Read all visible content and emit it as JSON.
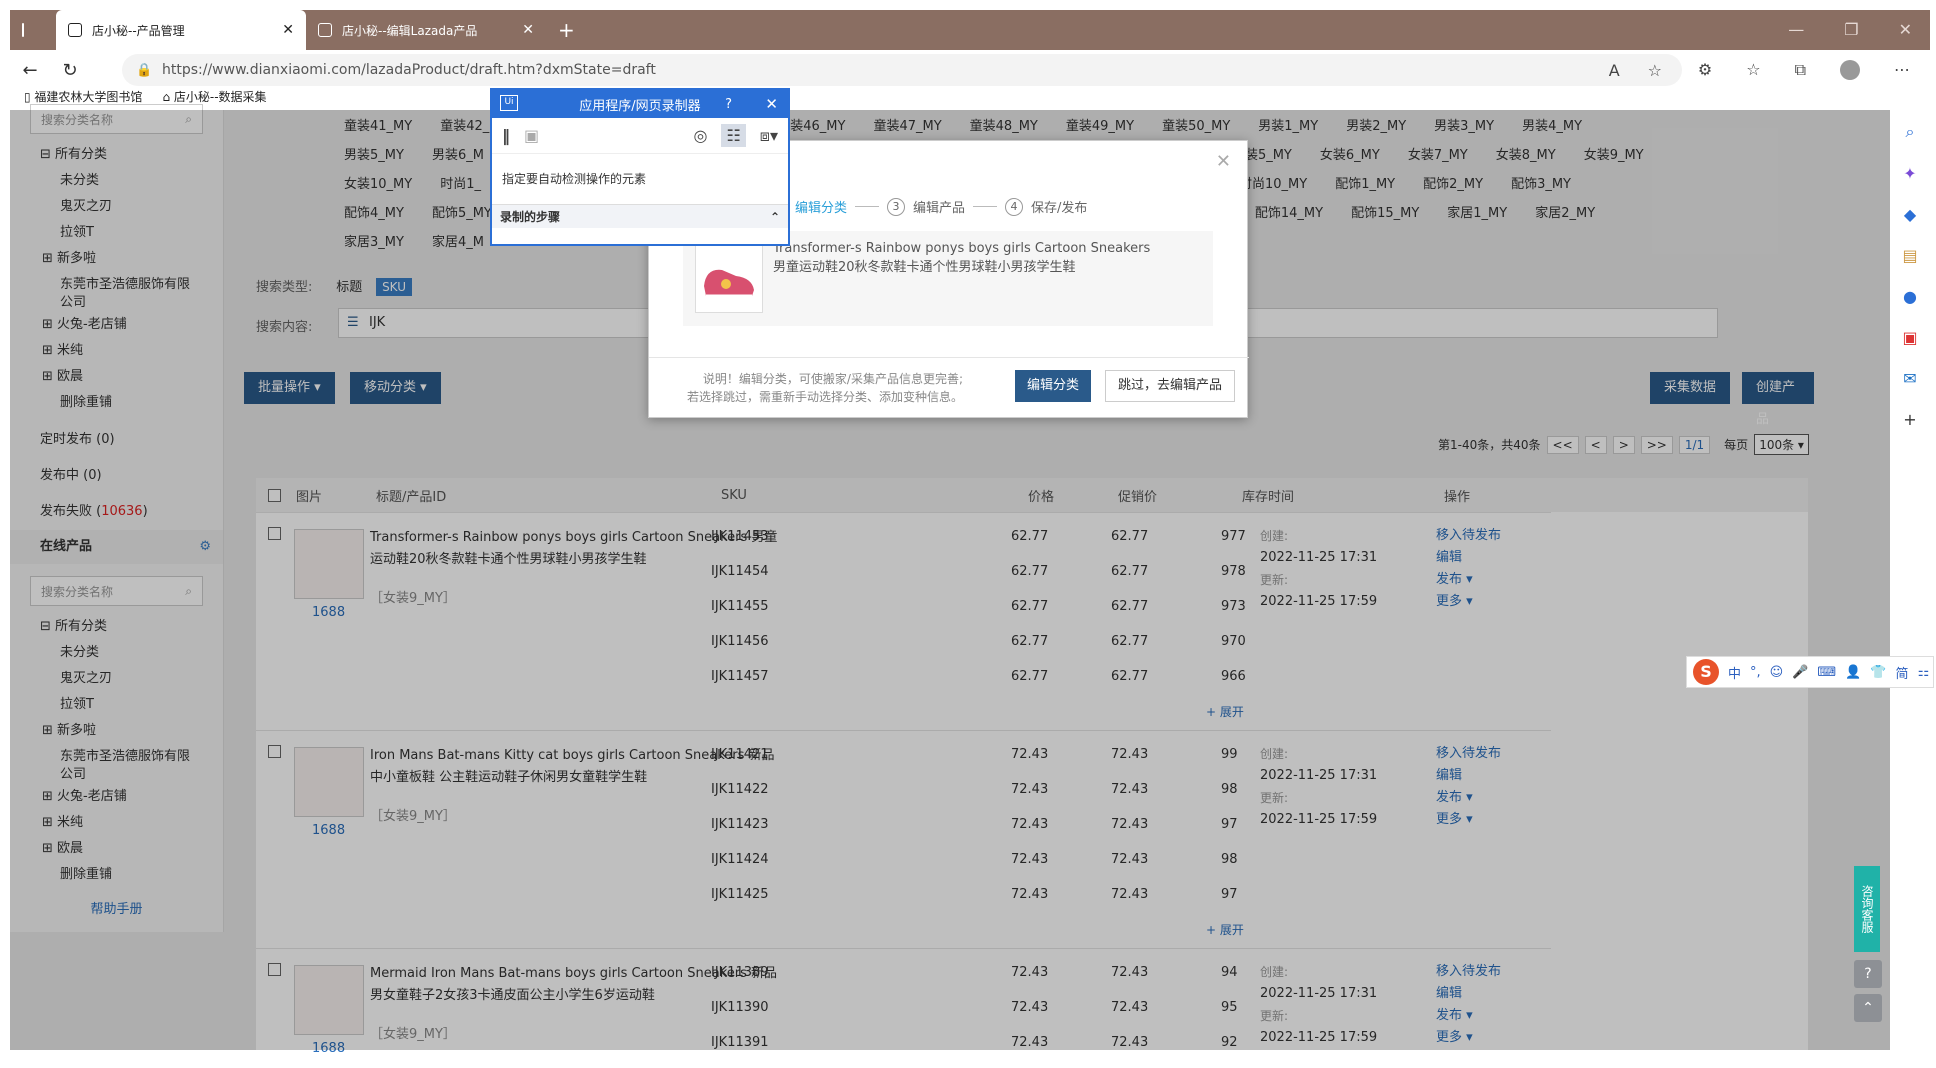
{
  "browser": {
    "tabs": [
      {
        "label": "店小秘--产品管理"
      },
      {
        "label": "店小秘--编辑Lazada产品"
      }
    ],
    "url": "https://www.dianxiaomi.com/lazadaProduct/draft.htm?dxmState=draft",
    "bookmarks": [
      "福建农林大学图书馆",
      "店小秘--数据采集"
    ]
  },
  "sidebar": {
    "search_placeholder": "搜索分类名称",
    "tree1": [
      "所有分类",
      "未分类",
      "鬼灭之刃",
      "拉领T",
      "新多啦",
      "东莞市圣浩德服饰有限公司",
      "火兔-老店铺",
      "米纯",
      "欧晨",
      "删除重铺"
    ],
    "links": {
      "scheduled": "定时发布 (0)",
      "publishing": "发布中 (0)",
      "failed_label": "发布失败 (",
      "failed_count": "10636",
      "failed_end": ")"
    },
    "online_label": "在线产品",
    "search2_placeholder": "搜索分类名称",
    "tree2": [
      "所有分类",
      "未分类",
      "鬼灭之刃",
      "拉领T",
      "新多啦",
      "东莞市圣浩德服饰有限公司",
      "火兔-老店铺",
      "米纯",
      "欧晨",
      "删除重铺"
    ],
    "help": "帮助手册"
  },
  "chips": {
    "row1": [
      "童装41_MY",
      "童装42_",
      "童装46_MY",
      "童装47_MY",
      "童装48_MY",
      "童装49_MY",
      "童装50_MY",
      "男装1_MY",
      "男装2_MY",
      "男装3_MY",
      "男装4_MY"
    ],
    "row2": [
      "男装5_MY",
      "男装6_M",
      "女装5_MY",
      "女装6_MY",
      "女装7_MY",
      "女装8_MY",
      "女装9_MY"
    ],
    "row3": [
      "女装10_MY",
      "时尚1_",
      "时尚10_MY",
      "配饰1_MY",
      "配饰2_MY",
      "配饰3_MY"
    ],
    "row4": [
      "配饰4_MY",
      "配饰5_MY",
      "配饰14_MY",
      "配饰15_MY",
      "家居1_MY",
      "家居2_MY"
    ],
    "row5": [
      "家居3_MY",
      "家居4_M"
    ]
  },
  "search": {
    "type_label": "搜索类型:",
    "type_title": "标题",
    "type_sku": "SKU",
    "content_label": "搜索内容:",
    "content_value": "IJK"
  },
  "toolbar": {
    "batch": "批量操作",
    "move": "移动分类",
    "collect": "采集数据",
    "create": "创建产品",
    "pagination": "第1-40条，共40条",
    "page": "1/1",
    "per_page_label": "每页",
    "per_page_value": "100条",
    "pager": [
      "<<",
      "<",
      ">",
      ">>"
    ]
  },
  "table": {
    "headers": [
      "图片",
      "标题/产品ID",
      "SKU",
      "价格",
      "促销价",
      "库存",
      "时间",
      "操作"
    ],
    "products": [
      {
        "img_label": "1688",
        "title": "Transformer-s Rainbow ponys boys girls Cartoon Sneakers 男童运动鞋20秋冬款鞋卡通个性男球鞋小男孩学生鞋",
        "tag": "［女装9_MY］",
        "rows": [
          {
            "sku": "IJK11453",
            "price": "62.77",
            "promo": "62.77",
            "stock": "977"
          },
          {
            "sku": "IJK11454",
            "price": "62.77",
            "promo": "62.77",
            "stock": "978"
          },
          {
            "sku": "IJK11455",
            "price": "62.77",
            "promo": "62.77",
            "stock": "973"
          },
          {
            "sku": "IJK11456",
            "price": "62.77",
            "promo": "62.77",
            "stock": "970"
          },
          {
            "sku": "IJK11457",
            "price": "62.77",
            "promo": "62.77",
            "stock": "966"
          }
        ],
        "created_label": "创建:",
        "created": "2022-11-25 17:31",
        "updated_label": "更新:",
        "updated": "2022-11-25 17:59",
        "expand": "+ 展开"
      },
      {
        "img_label": "1688",
        "title": "Iron Mans Bat-mans Kitty cat boys girls Cartoon Sneakers 新品中小童板鞋 公主鞋运动鞋子休闲男女童鞋学生鞋",
        "tag": "［女装9_MY］",
        "rows": [
          {
            "sku": "IJK11421",
            "price": "72.43",
            "promo": "72.43",
            "stock": "99"
          },
          {
            "sku": "IJK11422",
            "price": "72.43",
            "promo": "72.43",
            "stock": "98"
          },
          {
            "sku": "IJK11423",
            "price": "72.43",
            "promo": "72.43",
            "stock": "97"
          },
          {
            "sku": "IJK11424",
            "price": "72.43",
            "promo": "72.43",
            "stock": "98"
          },
          {
            "sku": "IJK11425",
            "price": "72.43",
            "promo": "72.43",
            "stock": "97"
          }
        ],
        "created_label": "创建:",
        "created": "2022-11-25 17:31",
        "updated_label": "更新:",
        "updated": "2022-11-25 17:59",
        "expand": "+ 展开"
      },
      {
        "img_label": "1688",
        "title": "Mermaid Iron Mans Bat-mans boys girls Cartoon Sneakers 新品男女童鞋子2女孩3卡通皮面公主小学生6岁运动鞋",
        "tag": "［女装9_MY］",
        "rows": [
          {
            "sku": "IJK11389",
            "price": "72.43",
            "promo": "72.43",
            "stock": "94"
          },
          {
            "sku": "IJK11390",
            "price": "72.43",
            "promo": "72.43",
            "stock": "95"
          },
          {
            "sku": "IJK11391",
            "price": "72.43",
            "promo": "72.43",
            "stock": "92"
          }
        ],
        "created_label": "创建:",
        "created": "2022-11-25 17:31",
        "updated_label": "更新:",
        "updated": "2022-11-25 17:59",
        "expand": ""
      }
    ],
    "ops": [
      "移入待发布",
      "编辑",
      "发布 ▾",
      "更多 ▾"
    ]
  },
  "modal": {
    "steps": [
      "编辑分类",
      "编辑产品",
      "保存/发布"
    ],
    "step_nums": [
      "2",
      "3",
      "4"
    ],
    "product_en": "Transformer-s Rainbow ponys boys girls Cartoon Sneakers",
    "product_cn": "男童运动鞋20秋冬款鞋卡通个性男球鞋小男孩学生鞋",
    "note1": "说明！编辑分类，可使搬家/采集产品信息更完善;",
    "note2": "若选择跳过，需重新手动选择分类、添加变种信息。",
    "btn_primary": "编辑分类",
    "btn_skip": "跳过，去编辑产品"
  },
  "recorder": {
    "title": "应用程序/网页录制器",
    "help": "?",
    "message": "指定要自动检测操作的元素",
    "steps_label": "录制的步骤"
  },
  "ime": [
    "中",
    "°,",
    "☺",
    "🎤",
    "⌨",
    "👤",
    "👕",
    "简",
    "⚏"
  ],
  "consult": "咨询客服"
}
